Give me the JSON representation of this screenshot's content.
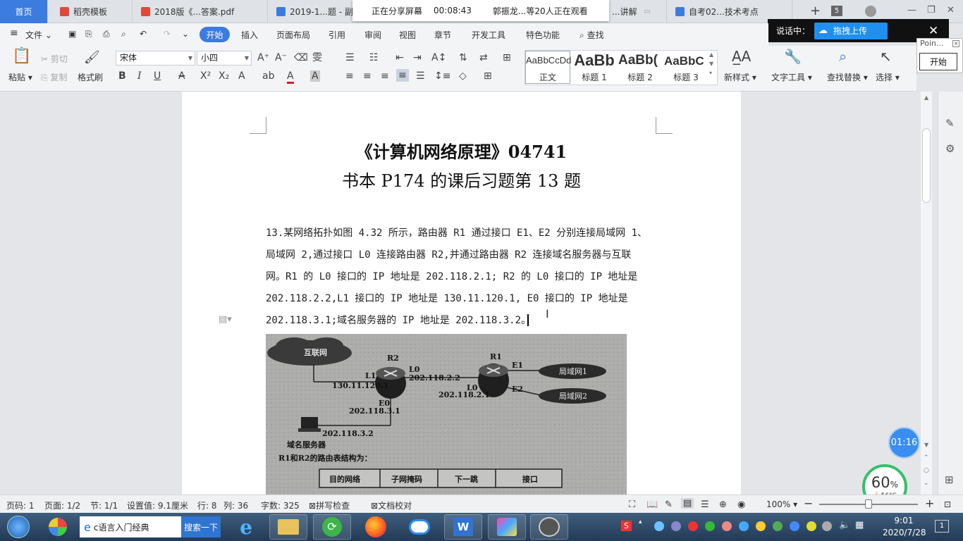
{
  "tabs": [
    {
      "label": "首页",
      "type": "home"
    },
    {
      "label": "稻壳模板",
      "icon": "docer-icon",
      "icon_color": "#e0483c"
    },
    {
      "label": "2018版《...答案.pdf",
      "icon": "pdf-icon",
      "icon_color": "#e0483c"
    },
    {
      "label": "2019-1...题 - 副本",
      "icon": "word-doc-icon",
      "icon_color": "#3c7be0"
    },
    {
      "label": "...讲解",
      "icon": "word-doc-icon",
      "icon_color": "#3c7be0"
    },
    {
      "label": "自考02...技术考点",
      "icon": "word-doc-icon",
      "icon_color": "#3c7be0"
    }
  ],
  "tab_count": "5",
  "share_banner": {
    "status": "正在分享屏幕",
    "elapsed": "00:08:43",
    "viewers": "郭振龙...等20人正在观看"
  },
  "speak_panel": {
    "label": "说话中：",
    "upload": "拖拽上传"
  },
  "menu": {
    "file": "文件",
    "items": [
      "开始",
      "插入",
      "页面布局",
      "引用",
      "审阅",
      "视图",
      "章节",
      "开发工具",
      "特色功能"
    ],
    "search": "查找"
  },
  "toolbar": {
    "paste": "粘贴",
    "cut": "剪切",
    "copy": "复制",
    "format_painter": "格式刷",
    "font_name": "宋体",
    "font_size": "小四",
    "styles": [
      {
        "preview": "AaBbCcDd",
        "name": "正文"
      },
      {
        "preview": "AaBb",
        "name": "标题 1"
      },
      {
        "preview": "AaBb(",
        "name": "标题 2"
      },
      {
        "preview": "AaBbC",
        "name": "标题 3"
      }
    ],
    "new_style": "新样式",
    "text_tools": "文字工具",
    "find_replace": "查找替换",
    "select": "选择"
  },
  "right_panel": {
    "preview_text": "Poin...",
    "start": "开始"
  },
  "document": {
    "title_line1": "《计算机网络原理》04741",
    "title_line2": "书本 P174 的课后习题第 13 题",
    "paragraph_lines": [
      "13.某网络拓扑如图 4.32 所示，路由器 R1 通过接口 E1、E2 分别连接局域网 1、",
      "局域网 2,通过接口 L0 连接路由器 R2,并通过路由器 R2 连接域名服务器与互联",
      "网。R1 的 L0 接口的 IP 地址是 202.118.2.1;  R2 的 L0 接口的 IP 地址是",
      "202.118.2.2,L1 接口的 IP 地址是 130.11.120.1,  E0 接口的 IP 地址是",
      "202.118.3.1;域名服务器的 IP 地址是 202.118.3.2。"
    ]
  },
  "figure": {
    "internet": "互联网",
    "r2": "R2",
    "r1": "R1",
    "r2_l1": "L1",
    "r2_l1_ip": "130.11.120.1",
    "r2_l0": "L0",
    "r2_l0_ip": "202.118.2.2",
    "r1_l0": "L0",
    "r1_l0_ip": "202.118.2.1",
    "r2_e0": "E0",
    "r2_e0_ip": "202.118.3.1",
    "r1_e1": "E1",
    "r1_e2": "E2",
    "lan1": "局域网1",
    "lan2": "局域网2",
    "dns_ip": "202.118.3.2",
    "dns": "域名服务器",
    "caption": "R1和R2的路由表结构为：",
    "table_headers": [
      "目的网络",
      "子网掩码",
      "下一跳",
      "接口"
    ]
  },
  "timer": "01:16",
  "gauge": {
    "value": "60",
    "unit": "%",
    "temp": "56°C"
  },
  "status": {
    "page_code": "页码: 1",
    "page": "页面: 1/2",
    "section": "节: 1/1",
    "setting": "设置值: 9.1厘米",
    "row": "行: 8",
    "col": "列: 36",
    "words": "字数: 325",
    "spell": "拼写检查",
    "proof": "文档校对",
    "zoom": "100%"
  },
  "taskbar": {
    "search_text": "c语言入门经典",
    "search_button": "搜索一下",
    "time": "9:01",
    "date": "2020/7/28"
  }
}
